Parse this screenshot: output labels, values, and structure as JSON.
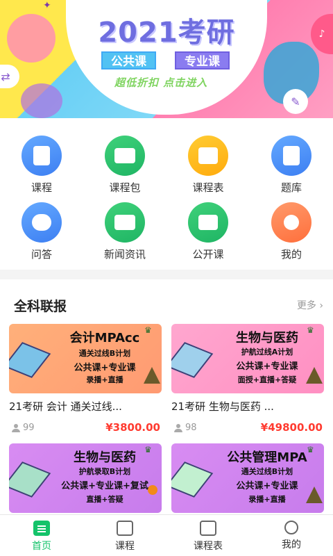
{
  "banner": {
    "title": "2021考研",
    "tag_public": "公共课",
    "tag_major": "专业课",
    "cta": "超低折扣 点击进入"
  },
  "grid": [
    {
      "label": "课程",
      "icon": "course-book-icon",
      "color": "#4a90f5"
    },
    {
      "label": "课程包",
      "icon": "open-book-icon",
      "color": "#22b866"
    },
    {
      "label": "课程表",
      "icon": "schedule-icon",
      "color": "#ffb81c"
    },
    {
      "label": "题库",
      "icon": "question-bank-icon",
      "color": "#4a90f5"
    },
    {
      "label": "问答",
      "icon": "qa-bubble-icon",
      "color": "#4a90f5"
    },
    {
      "label": "新闻资讯",
      "icon": "news-icon",
      "color": "#22b866"
    },
    {
      "label": "公开课",
      "icon": "video-play-icon",
      "color": "#22b866"
    },
    {
      "label": "我的",
      "icon": "user-icon",
      "color": "#ff7a45"
    }
  ],
  "section": {
    "title": "全科联报",
    "more": "更多 ›"
  },
  "courses": [
    {
      "img_title": "会计MPAcc",
      "img_sub1": "通关过线B计划",
      "img_sub2": "公共课+专业课",
      "img_sub3": "录播+直播",
      "title": "21考研 会计 通关过线...",
      "count": "99",
      "price": "¥3800.00"
    },
    {
      "img_title": "生物与医药",
      "img_sub1": "护航过线A计划",
      "img_sub2": "公共课+专业课",
      "img_sub3": "面授+直播+答疑",
      "title": "21考研 生物与医药 ...",
      "count": "98",
      "price": "¥49800.00"
    },
    {
      "img_title": "生物与医药",
      "img_sub1": "护航录取B计划",
      "img_sub2": "公共课+专业课+复试",
      "img_sub3": "直播+答疑"
    },
    {
      "img_title": "公共管理MPA",
      "img_sub1": "通关过线B计划",
      "img_sub2": "公共课+专业课",
      "img_sub3": "录播+直播"
    }
  ],
  "tabs": [
    {
      "label": "首页",
      "icon": "home-list-icon",
      "active": true
    },
    {
      "label": "课程",
      "icon": "course-icon",
      "active": false
    },
    {
      "label": "课程表",
      "icon": "schedule-icon",
      "active": false
    },
    {
      "label": "我的",
      "icon": "profile-icon",
      "active": false
    }
  ],
  "colors": {
    "accent": "#14c36a",
    "price": "#ff3b30"
  }
}
